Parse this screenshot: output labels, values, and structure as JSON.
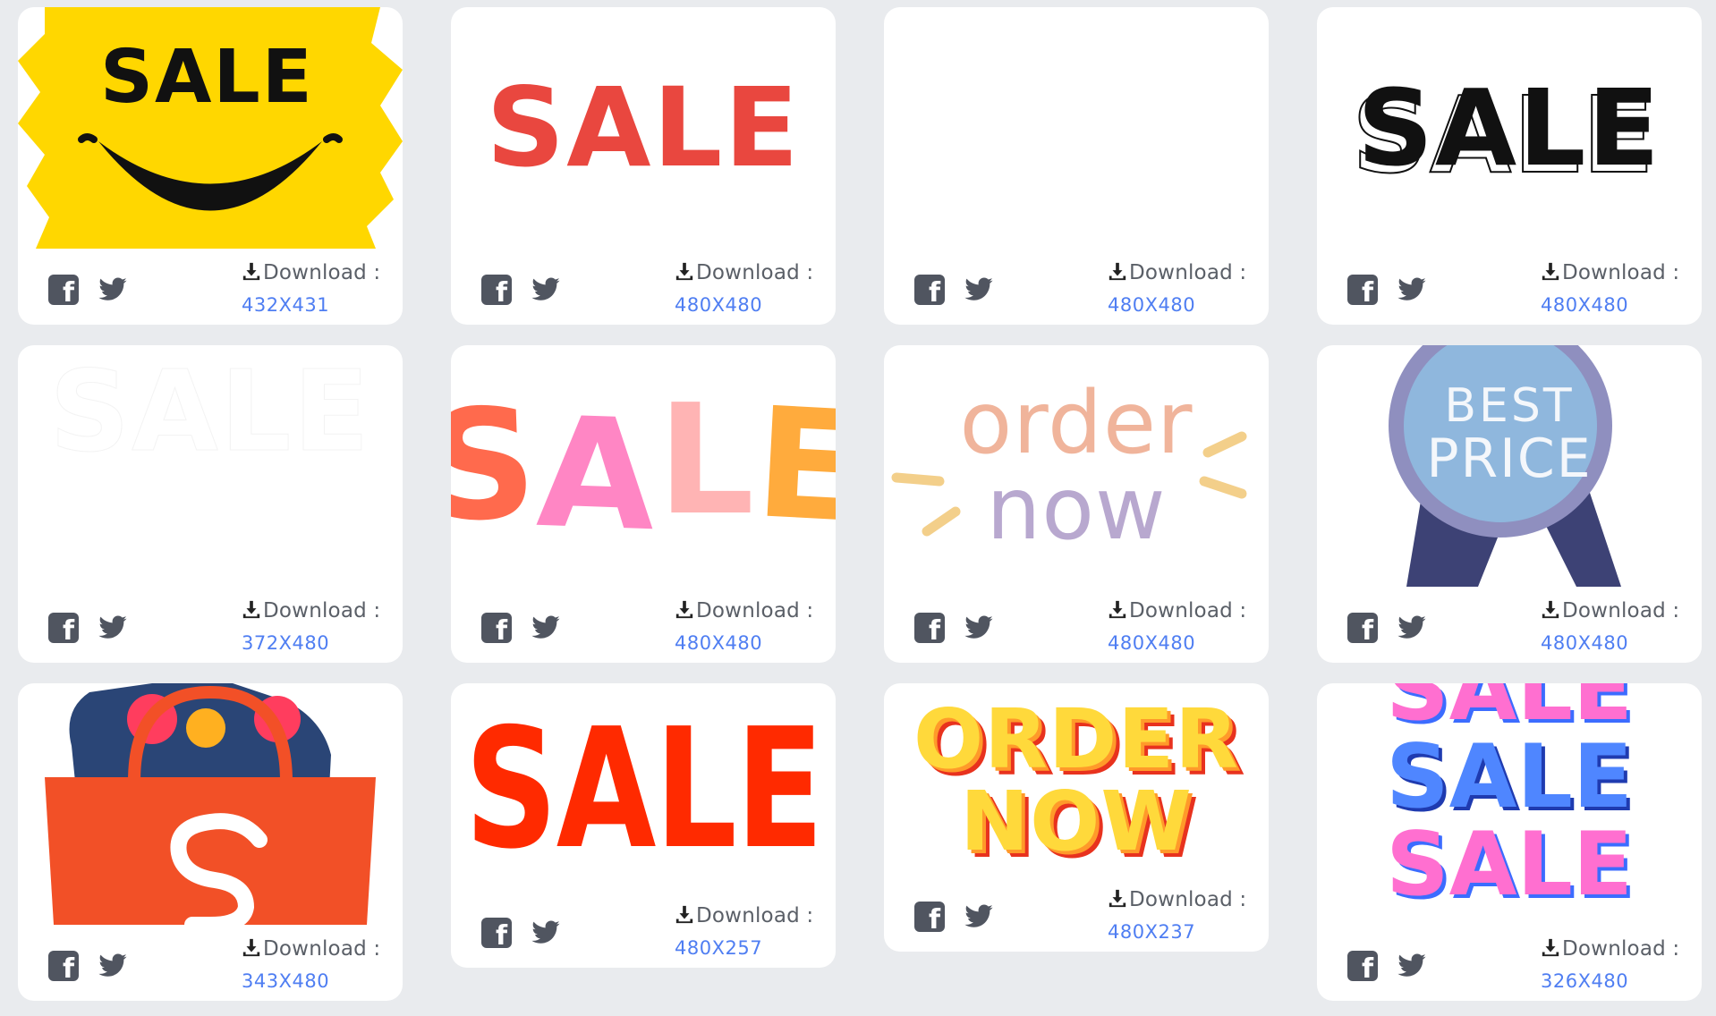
{
  "cards": [
    {
      "name": "sale-smile",
      "download_label": "Download :",
      "size": "432X431"
    },
    {
      "name": "sale-red",
      "download_label": "Download :",
      "size": "480X480",
      "image_text": "SALE"
    },
    {
      "name": "blank",
      "download_label": "Download :",
      "size": "480X480"
    },
    {
      "name": "sale-outline",
      "download_label": "Download :",
      "size": "480X480",
      "image_text": "SALE"
    },
    {
      "name": "sale-white",
      "download_label": "Download :",
      "size": "372X480",
      "image_text": "SALE"
    },
    {
      "name": "sale-colorful",
      "download_label": "Download :",
      "size": "480X480",
      "image_text": [
        "S",
        "A",
        "L",
        "E"
      ]
    },
    {
      "name": "order-now-pastel",
      "download_label": "Download :",
      "size": "480X480",
      "image_text": [
        "order",
        "now"
      ]
    },
    {
      "name": "best-price",
      "download_label": "Download :",
      "size": "480X480",
      "image_text": [
        "BEST",
        "PRICE"
      ]
    },
    {
      "name": "shopee-bag",
      "download_label": "Download :",
      "size": "343X480"
    },
    {
      "name": "sale-tall-red",
      "download_label": "Download :",
      "size": "480X257",
      "image_text": "SALE"
    },
    {
      "name": "order-now-yellow",
      "download_label": "Download :",
      "size": "480X237",
      "image_text": [
        "ORDER",
        "NOW"
      ]
    },
    {
      "name": "sale-stacked",
      "download_label": "Download :",
      "size": "326X480",
      "image_text": [
        "SALE",
        "SALE",
        "SALE"
      ]
    }
  ],
  "smile_sale_text": "SALE",
  "icons": {
    "facebook": "facebook-icon",
    "twitter": "twitter-icon",
    "download": "download-icon"
  },
  "colors": {
    "background": "#e9ebee",
    "card": "#ffffff",
    "link": "#4f7ef2",
    "icon": "#505560",
    "red": "#e9473f",
    "yellow": "#ffd700"
  }
}
